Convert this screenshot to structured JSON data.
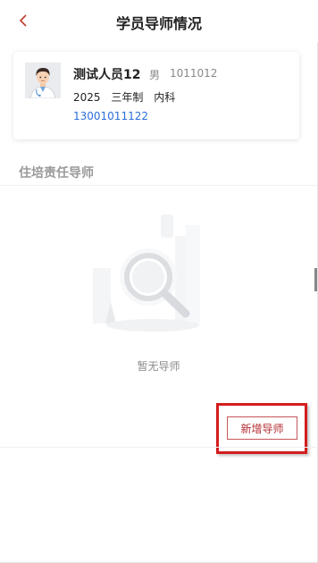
{
  "header": {
    "title": "学员导师情况"
  },
  "student": {
    "name": "测试人员12",
    "gender": "男",
    "id": "1011012",
    "year": "2025",
    "program": "三年制",
    "department": "内科",
    "phone": "13001011122"
  },
  "section": {
    "title": "住培责任导师"
  },
  "empty": {
    "text": "暂无导师"
  },
  "actions": {
    "add_label": "新增导师"
  },
  "colors": {
    "accent": "#b32a30",
    "link": "#2a6ed8",
    "highlight": "#d31d1d"
  }
}
